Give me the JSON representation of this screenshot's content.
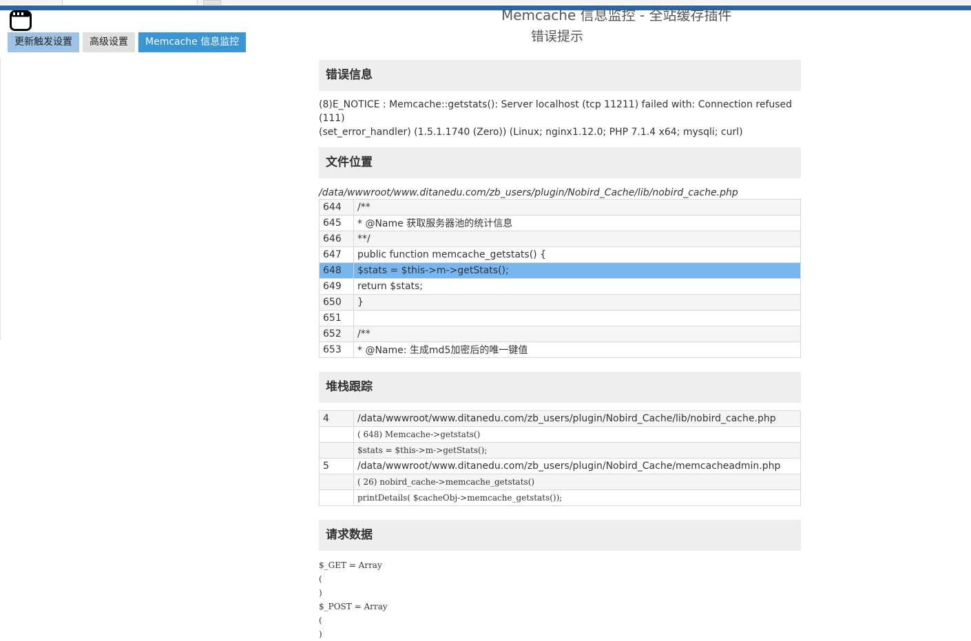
{
  "header": {
    "title": "Memcache 信息监控 - 全站缓存插件",
    "subtitle": "错误提示"
  },
  "tabs": [
    {
      "label": "更新触发设置"
    },
    {
      "label": "高级设置"
    },
    {
      "label": "Memcache 信息监控"
    }
  ],
  "error_section": {
    "heading": "错误信息",
    "line1": "(8)E_NOTICE : Memcache::getstats(): Server localhost (tcp 11211) failed with: Connection refused (111)",
    "line2": "(set_error_handler) (1.5.1.1740 (Zero)) (Linux; nginx1.12.0; PHP 7.1.4 x64; mysqli; curl)"
  },
  "file_section": {
    "heading": "文件位置",
    "path": "/data/wwwroot/www.ditanedu.com/zb_users/plugin/Nobird_Cache/lib/nobird_cache.php",
    "lines": [
      {
        "no": "644",
        "code": "/**"
      },
      {
        "no": "645",
        "code": "* @Name 获取服务器池的统计信息"
      },
      {
        "no": "646",
        "code": "**/"
      },
      {
        "no": "647",
        "code": "public function memcache_getstats() {"
      },
      {
        "no": "648",
        "code": "$stats = $this->m->getStats();"
      },
      {
        "no": "649",
        "code": "return $stats;"
      },
      {
        "no": "650",
        "code": "}"
      },
      {
        "no": "651",
        "code": ""
      },
      {
        "no": "652",
        "code": "/**"
      },
      {
        "no": "653",
        "code": "* @Name: 生成md5加密后的唯一键值"
      }
    ],
    "highlight_line": "648"
  },
  "stack_section": {
    "heading": "堆栈跟踪",
    "rows": [
      {
        "idx": "4",
        "text": "/data/wwwroot/www.ditanedu.com/zb_users/plugin/Nobird_Cache/lib/nobird_cache.php"
      },
      {
        "idx": "",
        "text": "( 648) Memcache->getstats()"
      },
      {
        "idx": "",
        "text": "$stats = $this->m->getStats();"
      },
      {
        "idx": "5",
        "text": "/data/wwwroot/www.ditanedu.com/zb_users/plugin/Nobird_Cache/memcacheadmin.php"
      },
      {
        "idx": "",
        "text": "( 26) nobird_cache->memcache_getstats()"
      },
      {
        "idx": "",
        "text": "printDetails( $cacheObj->memcache_getstats());"
      }
    ]
  },
  "request_section": {
    "heading": "请求数据",
    "dump": "$_GET = Array\n(\n)\n$_POST = Array\n(\n)"
  }
}
